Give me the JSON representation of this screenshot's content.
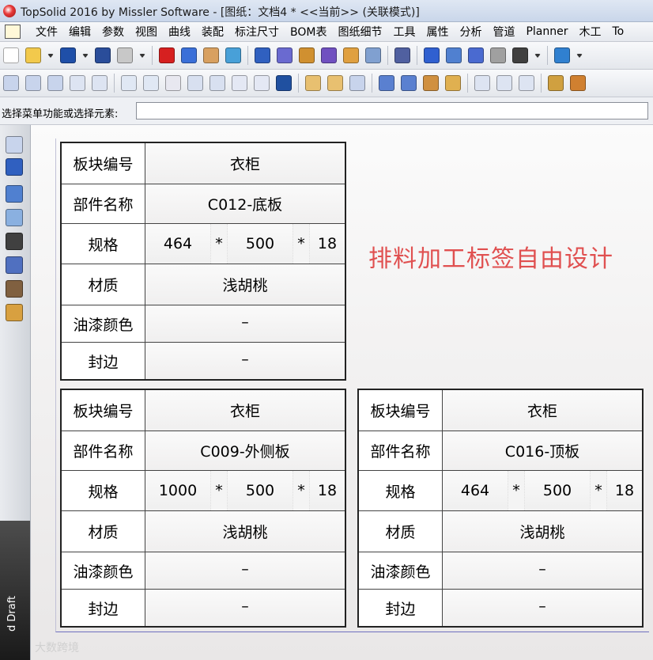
{
  "window": {
    "title": "TopSolid 2016 by Missler Software - [图纸：文档4 *  <<当前>> (关联模式)]"
  },
  "menu": [
    "文件",
    "编辑",
    "参数",
    "视图",
    "曲线",
    "装配",
    "标注尺寸",
    "BOM表",
    "图纸细节",
    "工具",
    "属性",
    "分析",
    "管道",
    "Planner",
    "木工",
    "To"
  ],
  "toolbar1": {
    "icons": [
      "new-file-icon",
      "open-folder-icon",
      "dropdown-arrow-icon",
      "save-icon",
      "dropdown-arrow-icon",
      "info-icon",
      "print-icon",
      "dropdown-arrow-icon",
      "delete-icon",
      "undo-icon",
      "eraser-icon",
      "cube-refresh-icon",
      "magnet-icon",
      "sliders-icon",
      "hammer-icon",
      "pliers-icon",
      "wrench-icon",
      "sad-face-icon",
      "branch-icon",
      "curve-check-icon",
      "cross-lines-icon",
      "bars-icon",
      "hook-icon",
      "signature-icon",
      "dropdown-arrow-icon",
      "zoom-icon",
      "dropdown-arrow-icon"
    ],
    "colors": [
      "#ffffff",
      "#f2c94c",
      "#333",
      "#1f4fa8",
      "#333",
      "#2a4d9a",
      "#c8c8c8",
      "#333",
      "#d62020",
      "#3a6fd8",
      "#d8a060",
      "#48a0d8",
      "#3060c0",
      "#6a6ad0",
      "#d09030",
      "#7050c0",
      "#e0a040",
      "#80a0d0",
      "#5060a0",
      "#3060d0",
      "#5080d0",
      "#4a6ad0",
      "#a0a0a0",
      "#404040",
      "#333",
      "#3080d0",
      "#333"
    ]
  },
  "toolbar2": {
    "icons": [
      "view-box-icon",
      "view-box-icon",
      "view-box-icon",
      "view-angle-icon",
      "view-select-icon",
      "grid-view-icon",
      "grid-view-icon",
      "stamp-view-icon",
      "section-view-icon",
      "detail-view-icon",
      "number-view-icon",
      "number-view-icon",
      "frame-view-icon",
      "pencil-view-icon",
      "pencil-view-icon",
      "small-view-icon",
      "blue-view-icon",
      "blue-view-icon",
      "colored-view-icon",
      "colored-view-icon",
      "view-box-icon",
      "view-box-icon",
      "view-box-icon",
      "pattern-view-icon",
      "pattern-view-icon"
    ],
    "colors": [
      "#c8d4ec",
      "#c8d4ec",
      "#c8d4ec",
      "#dde4f2",
      "#dde4f2",
      "#e0e8f4",
      "#e0e8f4",
      "#e8e8f0",
      "#d8e0f0",
      "#d8e0f0",
      "#e4e8f4",
      "#e4e8f4",
      "#2050a0",
      "#e8c070",
      "#e8c070",
      "#c8d4ec",
      "#5a80d0",
      "#5a80d0",
      "#d09040",
      "#e0b050",
      "#dde4f2",
      "#dde4f2",
      "#dde4f2",
      "#d0a040",
      "#d08030"
    ]
  },
  "prompt": {
    "label": "选择菜单功能或选择元素:",
    "value": ""
  },
  "sidebar": {
    "icons": [
      "select-icon",
      "edit-icon",
      "dimension-icon",
      "text-icon",
      "table-icon",
      "image-icon",
      "hinge-icon",
      "box-icon"
    ],
    "colors": [
      "#c8d4ec",
      "#3060c0",
      "#5080d0",
      "#8ab0e0",
      "#404040",
      "#5070c0",
      "#806040",
      "#d8a040"
    ],
    "strip_text": "d Draft"
  },
  "headline": "排料加工标签自由设计",
  "labels": [
    {
      "rows": [
        {
          "label": "板块编号",
          "value": "衣柜"
        },
        {
          "label": "部件名称",
          "value": "C012-底板"
        },
        {
          "label": "规格",
          "dims": [
            "464",
            "500",
            "18"
          ],
          "times": "*"
        },
        {
          "label": "材质",
          "value": "浅胡桃"
        },
        {
          "label": "油漆颜色",
          "value": "–"
        },
        {
          "label": "封边",
          "value": "–"
        }
      ]
    },
    {
      "rows": [
        {
          "label": "板块编号",
          "value": "衣柜"
        },
        {
          "label": "部件名称",
          "value": "C009-外侧板"
        },
        {
          "label": "规格",
          "dims": [
            "1000",
            "500",
            "18"
          ],
          "times": "*"
        },
        {
          "label": "材质",
          "value": "浅胡桃"
        },
        {
          "label": "油漆颜色",
          "value": "–"
        },
        {
          "label": "封边",
          "value": "–"
        }
      ]
    },
    {
      "rows": [
        {
          "label": "板块编号",
          "value": "衣柜"
        },
        {
          "label": "部件名称",
          "value": "C016-顶板"
        },
        {
          "label": "规格",
          "dims": [
            "464",
            "500",
            "18"
          ],
          "times": "*"
        },
        {
          "label": "材质",
          "value": "浅胡桃"
        },
        {
          "label": "油漆颜色",
          "value": "–"
        },
        {
          "label": "封边",
          "value": "–"
        }
      ]
    }
  ],
  "watermark": "大数跨境"
}
